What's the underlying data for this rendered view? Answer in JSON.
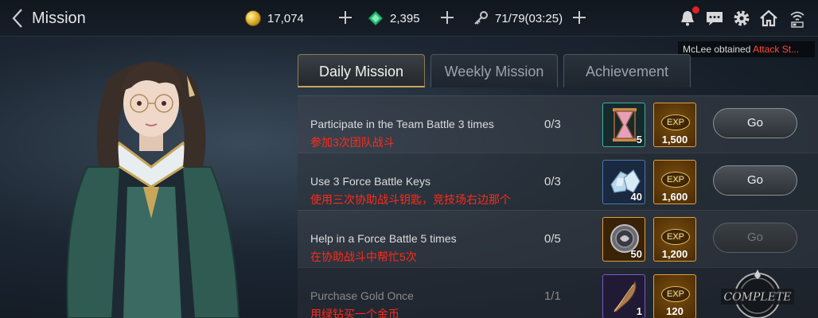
{
  "header": {
    "title": "Mission",
    "gold": "17,074",
    "gems": "2,395",
    "stamina": "71/79(03:25)"
  },
  "notification": {
    "prefix": "McLee obtained ",
    "highlight": "Attack St..."
  },
  "tabs": [
    {
      "label": "Daily Mission",
      "active": true
    },
    {
      "label": "Weekly Mission",
      "active": false
    },
    {
      "label": "Achievement",
      "active": false
    }
  ],
  "missions": [
    {
      "title": "Participate in the Team Battle 3 times",
      "note": "参加3次团队战斗",
      "progress": "0/3",
      "reward_icon": "hourglass-icon",
      "reward_qty": "5",
      "exp_label": "EXP",
      "exp": "1,500",
      "action": "Go"
    },
    {
      "title": "Use 3 Force Battle Keys",
      "note": "使用三次协助战斗钥匙，竞技场右边那个",
      "progress": "0/3",
      "reward_icon": "crystal-icon",
      "reward_qty": "40",
      "exp_label": "EXP",
      "exp": "1,600",
      "action": "Go"
    },
    {
      "title": "Help in a Force Battle 5 times",
      "note": "在协助战斗中帮忙5次",
      "progress": "0/5",
      "reward_icon": "orb-icon",
      "reward_qty": "50",
      "exp_label": "EXP",
      "exp": "1,200",
      "action": "Go"
    },
    {
      "title": "Purchase Gold Once",
      "note": "用绿钻买一个金币",
      "progress": "1/1",
      "reward_icon": "feather-icon",
      "reward_qty": "1",
      "exp_label": "EXP",
      "exp": "120",
      "status": "COMPLETE"
    }
  ],
  "colors": {
    "note_red": "#ff2a1a",
    "exp_gold": "#e0a040",
    "tab_accent": "#c9a65a"
  }
}
